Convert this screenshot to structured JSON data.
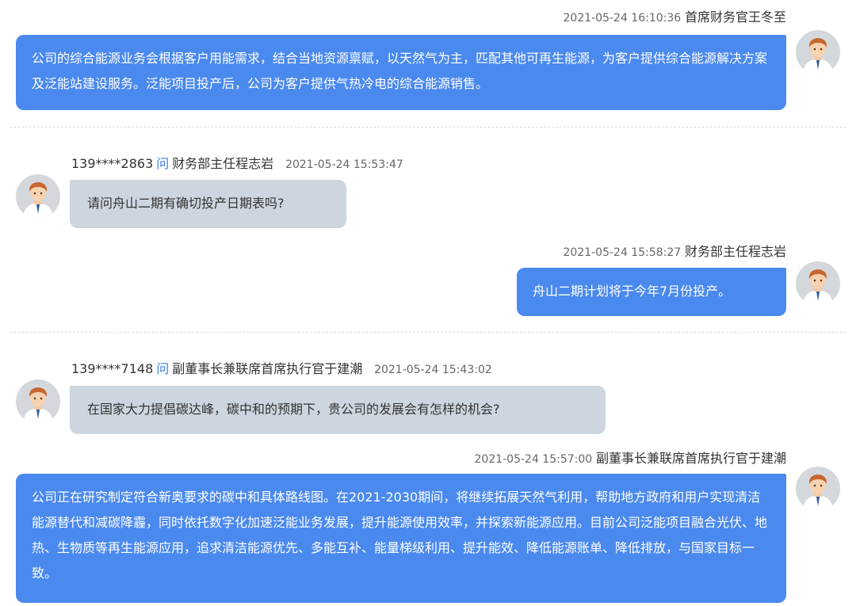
{
  "messages": [
    {
      "time": "2021-05-24 16:10:36",
      "author": "首席财务官王冬至",
      "text": "公司的综合能源业务会根据客户用能需求，结合当地资源禀赋，以天然气为主，匹配其他可再生能源，为客户提供综合能源解决方案及泛能站建设服务。泛能项目投产后，公司为客户提供气热冷电的综合能源销售。"
    },
    {
      "phone": "139****2863",
      "q_label": "问",
      "author": "财务部主任程志岩",
      "time": "2021-05-24 15:53:47",
      "text": "请问舟山二期有确切投产日期表吗?"
    },
    {
      "time": "2021-05-24 15:58:27",
      "author": "财务部主任程志岩",
      "text": "舟山二期计划将于今年7月份投产。"
    },
    {
      "phone": "139****7148",
      "q_label": "问",
      "author": "副董事长兼联席首席执行官于建潮",
      "time": "2021-05-24 15:43:02",
      "text": "在国家大力提倡碳达峰，碳中和的预期下，贵公司的发展会有怎样的机会?"
    },
    {
      "time": "2021-05-24 15:57:00",
      "author": "副董事长兼联席首席执行官于建潮",
      "text": "公司正在研究制定符合新奥要求的碳中和具体路线图。在2021-2030期间，将继续拓展天然气利用，帮助地方政府和用户实现清洁能源替代和减碳降霾，同时依托数字化加速泛能业务发展，提升能源使用效率，并探索新能源应用。目前公司泛能项目融合光伏、地热、生物质等再生能源应用，追求清洁能源优先、多能互补、能量梯级利用、提升能效、降低能源账单、降低排放，与国家目标一致。"
    }
  ],
  "colors": {
    "answer_bubble": "#4a89ee",
    "question_bubble": "#cdd6df",
    "question_mark": "#3a7de0"
  },
  "icons": {
    "avatar": "person-avatar-icon"
  }
}
